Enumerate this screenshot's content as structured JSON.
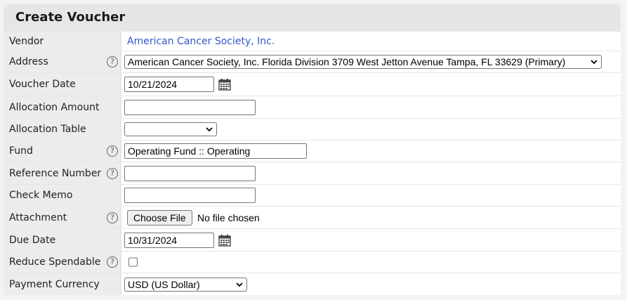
{
  "title": "Create Voucher",
  "rows": {
    "vendor": {
      "label": "Vendor",
      "value": "American Cancer Society, Inc."
    },
    "address": {
      "label": "Address",
      "value": "American Cancer Society, Inc. Florida Division 3709 West Jetton Avenue Tampa, FL 33629 (Primary)"
    },
    "voucher_date": {
      "label": "Voucher Date",
      "value": "10/21/2024"
    },
    "allocation_amount": {
      "label": "Allocation Amount",
      "value": ""
    },
    "allocation_table": {
      "label": "Allocation Table",
      "value": ""
    },
    "fund": {
      "label": "Fund",
      "value": "Operating Fund :: Operating"
    },
    "reference_number": {
      "label": "Reference Number",
      "value": ""
    },
    "check_memo": {
      "label": "Check Memo",
      "value": ""
    },
    "attachment": {
      "label": "Attachment",
      "button": "Choose File",
      "status": "No file chosen"
    },
    "due_date": {
      "label": "Due Date",
      "value": "10/31/2024"
    },
    "reduce_spendable": {
      "label": "Reduce Spendable",
      "checked": false
    },
    "payment_currency": {
      "label": "Payment Currency",
      "value": "USD (US Dollar)"
    }
  },
  "help_glyph": "?",
  "colors": {
    "link": "#3355cc",
    "label_bg": "#ececee",
    "value_bg": "#ffffff"
  }
}
